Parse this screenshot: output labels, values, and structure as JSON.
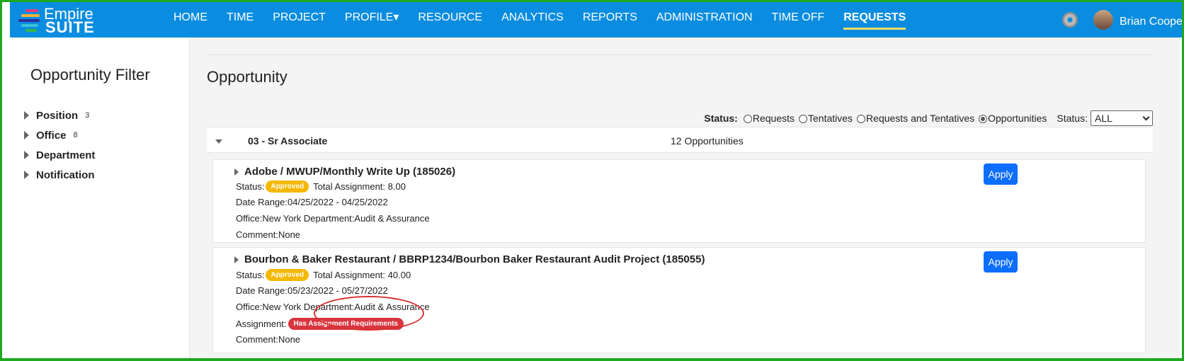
{
  "header": {
    "logo_line1": "Empire",
    "logo_line2": "SUITE",
    "nav": [
      "HOME",
      "TIME",
      "PROJECT",
      "PROFILE▾",
      "RESOURCE",
      "ANALYTICS",
      "REPORTS",
      "ADMINISTRATION",
      "TIME OFF",
      "REQUESTS"
    ],
    "active_nav": "REQUESTS",
    "user_name": "Brian Cooper ▾"
  },
  "sidebar": {
    "title": "Opportunity Filter",
    "filters": [
      {
        "label": "Position",
        "count": "3"
      },
      {
        "label": "Office",
        "count": "8"
      },
      {
        "label": "Department",
        "count": ""
      },
      {
        "label": "Notification",
        "count": ""
      }
    ]
  },
  "main": {
    "title": "Opportunity",
    "status_filter": {
      "label": "Status:",
      "options": [
        "Requests",
        "Tentatives",
        "Requests and Tentatives",
        "Opportunities"
      ],
      "selected": "Opportunities",
      "select_label": "Status:",
      "select_value": "ALL"
    },
    "group": {
      "name": "03 - Sr Associate",
      "count": "12 Opportunities"
    },
    "cards": [
      {
        "title": "Adobe / MWUP/Monthly Write Up (185026)",
        "status_label": "Status:",
        "status_badge": "Approved",
        "total_assignment": "Total Assignment: 8.00",
        "date_range": "Date Range:04/25/2022 - 04/25/2022",
        "office_dept": "Office:New York Department:Audit & Assurance",
        "comment": "Comment:None",
        "apply": "Apply"
      },
      {
        "title": "Bourbon & Baker Restaurant / BBRP1234/Bourbon Baker Restaurant Audit Project (185055)",
        "status_label": "Status:",
        "status_badge": "Approved",
        "total_assignment": "Total Assignment: 40.00",
        "date_range": "Date Range:05/23/2022 - 05/27/2022",
        "office_dept": "Office:New York Department:Audit & Assurance",
        "assignment_label": "Assignment:",
        "assignment_badge": "Has Assignment Requirements",
        "comment": "Comment:None",
        "apply": "Apply"
      }
    ]
  },
  "colors": {
    "header_bg": "#0a8de0",
    "apply_button": "#0d6efd",
    "approved_badge": "#f5b800",
    "requirements_badge": "#d8353f",
    "annotation_circle": "#d93030",
    "frame_border": "#1fa81f"
  }
}
